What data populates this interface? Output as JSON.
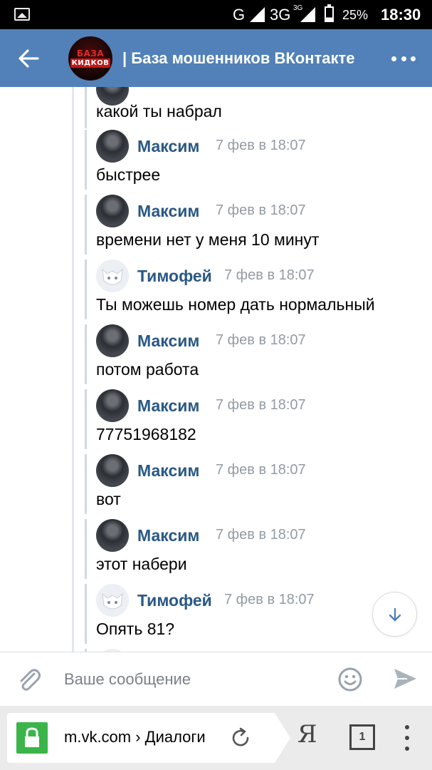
{
  "status_bar": {
    "network": "G",
    "network_3g": "3G",
    "network_3g_small": "3G",
    "battery": "25%",
    "time": "18:30"
  },
  "header": {
    "avatar_line1": "БАЗА",
    "avatar_line2": "КИДКОВ",
    "title": "| База мошенников ВКонтакте",
    "back_icon": "arrow-left-icon",
    "more_icon": "more-horizontal-icon"
  },
  "messages": [
    {
      "author": "",
      "time": "",
      "text": "какой ты набрал"
    },
    {
      "author": "Максим",
      "time": "7 фев в 18:07",
      "text": "быстрее"
    },
    {
      "author": "Максим",
      "time": "7 фев в 18:07",
      "text": "времени нет у меня 10 минут"
    },
    {
      "author": "Тимофей",
      "time": "7 фев в 18:07",
      "text": "Ты можешь номер дать нормальный"
    },
    {
      "author": "Максим",
      "time": "7 фев в 18:07",
      "text": "потом работа"
    },
    {
      "author": "Максим",
      "time": "7 фев в 18:07",
      "text": "77751968182"
    },
    {
      "author": "Максим",
      "time": "7 фев в 18:07",
      "text": "вот"
    },
    {
      "author": "Максим",
      "time": "7 фев в 18:07",
      "text": "этот набери"
    },
    {
      "author": "Тимофей",
      "time": "7 фев в 18:07",
      "text": "Опять 81?"
    }
  ],
  "compose": {
    "placeholder": "Ваше сообщение"
  },
  "browser": {
    "url": "m.vk.com › Диалоги",
    "yandex_label": "Я",
    "tab_count": "1"
  },
  "colors": {
    "header_bg": "#5181b8",
    "author": "#2a5885",
    "time": "#939ba3",
    "lock": "#3bb54a"
  }
}
